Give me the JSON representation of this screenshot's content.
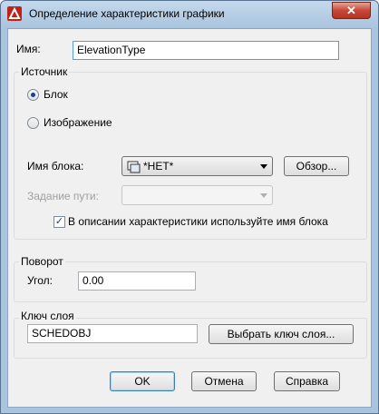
{
  "window": {
    "title": "Определение характеристики графики"
  },
  "name_field": {
    "label": "Имя:",
    "value": "ElevationType"
  },
  "source": {
    "title": "Источник",
    "radio_block": "Блок",
    "radio_image": "Изображение",
    "block_name_label": "Имя блока:",
    "block_name_value": "*НЕТ*",
    "browse_button": "Обзор...",
    "path_label": "Задание пути:",
    "path_value": "",
    "checkbox_label": "В описании характеристики используйте имя блока",
    "checkbox_checked": true,
    "selected": "block"
  },
  "rotation": {
    "title": "Поворот",
    "angle_label": "Угол:",
    "angle_value": "0.00"
  },
  "layer_key": {
    "title": "Ключ слоя",
    "value": "SCHEDOBJ",
    "select_button": "Выбрать ключ слоя..."
  },
  "buttons": {
    "ok": "OK",
    "cancel": "Отмена",
    "help": "Справка"
  },
  "colors": {
    "accent": "#1a3f8c",
    "title_bar": "#a9c4de",
    "close": "#c7473a"
  }
}
